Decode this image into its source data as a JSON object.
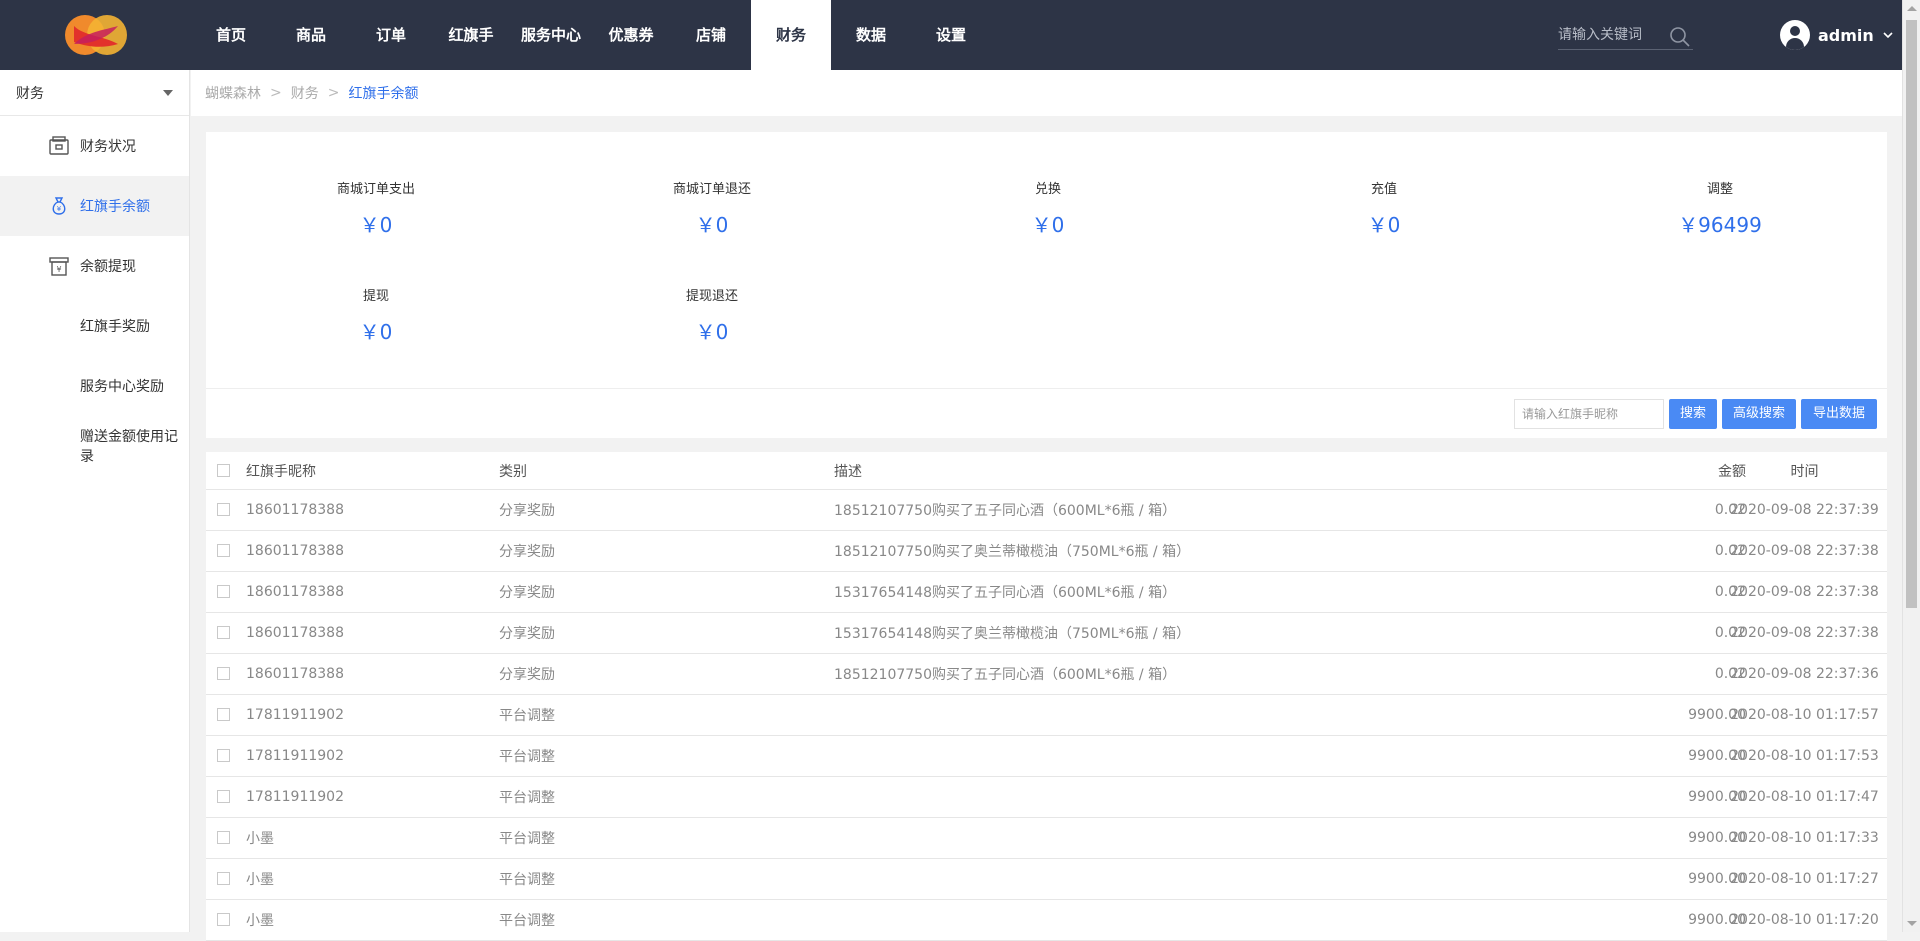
{
  "app": {
    "logo": "logo-icon"
  },
  "nav": {
    "items": [
      {
        "label": "首页",
        "active": false
      },
      {
        "label": "商品",
        "active": false
      },
      {
        "label": "订单",
        "active": false
      },
      {
        "label": "红旗手",
        "active": false
      },
      {
        "label": "服务中心",
        "active": false
      },
      {
        "label": "优惠券",
        "active": false
      },
      {
        "label": "店铺",
        "active": false
      },
      {
        "label": "财务",
        "active": true
      },
      {
        "label": "数据",
        "active": false
      },
      {
        "label": "设置",
        "active": false
      }
    ],
    "search_placeholder": "请输入关键词",
    "user_name": "admin"
  },
  "sidebar": {
    "select_value": "财务",
    "items": [
      {
        "label": "财务状况",
        "icon": "wallet-icon",
        "active": false
      },
      {
        "label": "红旗手余额",
        "icon": "money-bag-icon",
        "active": true
      },
      {
        "label": "余额提现",
        "icon": "withdraw-icon",
        "active": false
      },
      {
        "label": "红旗手奖励",
        "icon": "",
        "active": false
      },
      {
        "label": "服务中心奖励",
        "icon": "",
        "active": false
      },
      {
        "label": "赠送金额使用记录",
        "icon": "",
        "active": false
      }
    ]
  },
  "breadcrumb": {
    "items": [
      "蝴蝶森林",
      "财务"
    ],
    "current": "红旗手余额",
    "separator": ">"
  },
  "stats": [
    {
      "label": "商城订单支出",
      "value": "￥0"
    },
    {
      "label": "商城订单退还",
      "value": "￥0"
    },
    {
      "label": "兑换",
      "value": "￥0"
    },
    {
      "label": "充值",
      "value": "￥0"
    },
    {
      "label": "调整",
      "value": "￥96499"
    },
    {
      "label": "提现",
      "value": "￥0"
    },
    {
      "label": "提现退还",
      "value": "￥0"
    }
  ],
  "toolbar": {
    "search_placeholder": "请输入红旗手昵称",
    "search_label": "搜索",
    "advanced_label": "高级搜索",
    "export_label": "导出数据"
  },
  "table": {
    "columns": [
      "红旗手昵称",
      "类别",
      "描述",
      "金额",
      "时间"
    ],
    "rows": [
      [
        "18601178388",
        "分享奖励",
        "18512107750购买了五子同心酒（600ML*6瓶 / 箱）",
        "0.02",
        "2020-09-08 22:37:39"
      ],
      [
        "18601178388",
        "分享奖励",
        "18512107750购买了奥兰蒂橄榄油（750ML*6瓶 / 箱）",
        "0.02",
        "2020-09-08 22:37:38"
      ],
      [
        "18601178388",
        "分享奖励",
        "15317654148购买了五子同心酒（600ML*6瓶 / 箱）",
        "0.02",
        "2020-09-08 22:37:38"
      ],
      [
        "18601178388",
        "分享奖励",
        "15317654148购买了奥兰蒂橄榄油（750ML*6瓶 / 箱）",
        "0.02",
        "2020-09-08 22:37:38"
      ],
      [
        "18601178388",
        "分享奖励",
        "18512107750购买了五子同心酒（600ML*6瓶 / 箱）",
        "0.02",
        "2020-09-08 22:37:36"
      ],
      [
        "17811911902",
        "平台调整",
        "",
        "9900.00",
        "2020-08-10 01:17:57"
      ],
      [
        "17811911902",
        "平台调整",
        "",
        "9900.00",
        "2020-08-10 01:17:53"
      ],
      [
        "17811911902",
        "平台调整",
        "",
        "9900.00",
        "2020-08-10 01:17:47"
      ],
      [
        "小墨",
        "平台调整",
        "",
        "9900.00",
        "2020-08-10 01:17:33"
      ],
      [
        "小墨",
        "平台调整",
        "",
        "9900.00",
        "2020-08-10 01:17:27"
      ],
      [
        "小墨",
        "平台调整",
        "",
        "9900.00",
        "2020-08-10 01:17:20"
      ]
    ]
  },
  "colors": {
    "topbar": "#2d3446",
    "accent": "#2f6fea",
    "button": "#4a8af4"
  }
}
